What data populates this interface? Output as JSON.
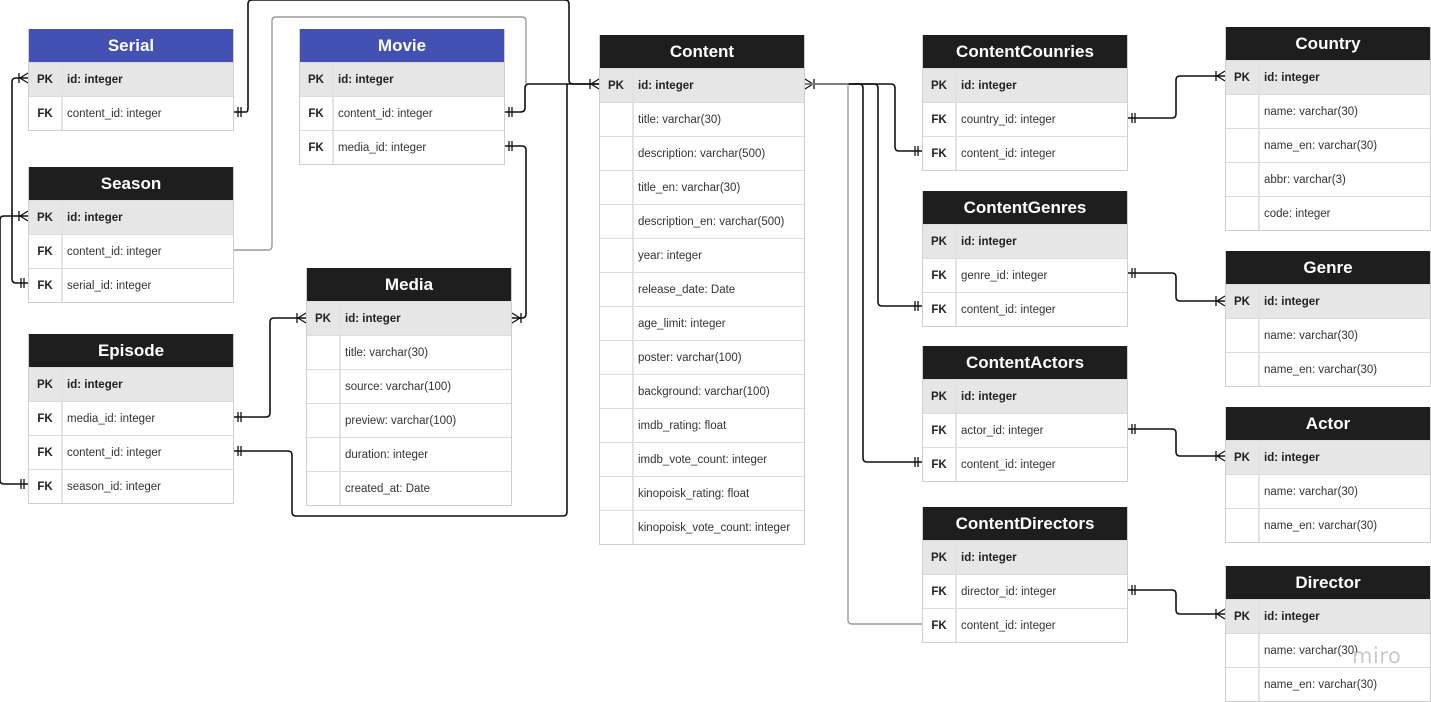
{
  "diagram": {
    "watermark": "miro",
    "entities": {
      "serial": {
        "title": "Serial",
        "rows": [
          {
            "key": "PK",
            "field": "id: integer"
          },
          {
            "key": "FK",
            "field": "content_id: integer"
          }
        ]
      },
      "movie": {
        "title": "Movie",
        "rows": [
          {
            "key": "PK",
            "field": "id: integer"
          },
          {
            "key": "FK",
            "field": "content_id: integer"
          },
          {
            "key": "FK",
            "field": "media_id: integer"
          }
        ]
      },
      "season": {
        "title": "Season",
        "rows": [
          {
            "key": "PK",
            "field": "id: integer"
          },
          {
            "key": "FK",
            "field": "content_id: integer"
          },
          {
            "key": "FK",
            "field": "serial_id: integer"
          }
        ]
      },
      "episode": {
        "title": "Episode",
        "rows": [
          {
            "key": "PK",
            "field": "id: integer"
          },
          {
            "key": "FK",
            "field": "media_id: integer"
          },
          {
            "key": "FK",
            "field": "content_id: integer"
          },
          {
            "key": "FK",
            "field": "season_id: integer"
          }
        ]
      },
      "media": {
        "title": "Media",
        "rows": [
          {
            "key": "PK",
            "field": "id: integer"
          },
          {
            "key": "",
            "field": "title: varchar(30)"
          },
          {
            "key": "",
            "field": "source: varchar(100)"
          },
          {
            "key": "",
            "field": "preview: varchar(100)"
          },
          {
            "key": "",
            "field": "duration: integer"
          },
          {
            "key": "",
            "field": "created_at: Date"
          }
        ]
      },
      "content": {
        "title": "Content",
        "rows": [
          {
            "key": "PK",
            "field": "id: integer"
          },
          {
            "key": "",
            "field": "title: varchar(30)"
          },
          {
            "key": "",
            "field": "description: varchar(500)"
          },
          {
            "key": "",
            "field": "title_en: varchar(30)"
          },
          {
            "key": "",
            "field": "description_en: varchar(500)"
          },
          {
            "key": "",
            "field": "year: integer"
          },
          {
            "key": "",
            "field": "release_date: Date"
          },
          {
            "key": "",
            "field": "age_limit: integer"
          },
          {
            "key": "",
            "field": "poster: varchar(100)"
          },
          {
            "key": "",
            "field": "background: varchar(100)"
          },
          {
            "key": "",
            "field": "imdb_rating: float"
          },
          {
            "key": "",
            "field": "imdb_vote_count: integer"
          },
          {
            "key": "",
            "field": "kinopoisk_rating: float"
          },
          {
            "key": "",
            "field": "kinopoisk_vote_count: integer"
          }
        ]
      },
      "content_countries": {
        "title": "ContentCounries",
        "rows": [
          {
            "key": "PK",
            "field": "id: integer"
          },
          {
            "key": "FK",
            "field": "country_id: integer"
          },
          {
            "key": "FK",
            "field": "content_id: integer"
          }
        ]
      },
      "content_genres": {
        "title": "ContentGenres",
        "rows": [
          {
            "key": "PK",
            "field": "id: integer"
          },
          {
            "key": "FK",
            "field": "genre_id: integer"
          },
          {
            "key": "FK",
            "field": "content_id: integer"
          }
        ]
      },
      "content_actors": {
        "title": "ContentActors",
        "rows": [
          {
            "key": "PK",
            "field": "id: integer"
          },
          {
            "key": "FK",
            "field": "actor_id: integer"
          },
          {
            "key": "FK",
            "field": "content_id: integer"
          }
        ]
      },
      "content_directors": {
        "title": "ContentDirectors",
        "rows": [
          {
            "key": "PK",
            "field": "id: integer"
          },
          {
            "key": "FK",
            "field": "director_id: integer"
          },
          {
            "key": "FK",
            "field": "content_id: integer"
          }
        ]
      },
      "country": {
        "title": "Country",
        "rows": [
          {
            "key": "PK",
            "field": "id: integer"
          },
          {
            "key": "",
            "field": "name: varchar(30)"
          },
          {
            "key": "",
            "field": "name_en: varchar(30)"
          },
          {
            "key": "",
            "field": "abbr: varchar(3)"
          },
          {
            "key": "",
            "field": "code: integer"
          }
        ]
      },
      "genre": {
        "title": "Genre",
        "rows": [
          {
            "key": "PK",
            "field": "id: integer"
          },
          {
            "key": "",
            "field": "name: varchar(30)"
          },
          {
            "key": "",
            "field": "name_en: varchar(30)"
          }
        ]
      },
      "actor": {
        "title": "Actor",
        "rows": [
          {
            "key": "PK",
            "field": "id: integer"
          },
          {
            "key": "",
            "field": "name: varchar(30)"
          },
          {
            "key": "",
            "field": "name_en: varchar(30)"
          }
        ]
      },
      "director": {
        "title": "Director",
        "rows": [
          {
            "key": "PK",
            "field": "id: integer"
          },
          {
            "key": "",
            "field": "name: varchar(30)"
          },
          {
            "key": "",
            "field": "name_en: varchar(30)"
          }
        ]
      }
    },
    "relations": [
      {
        "from": "serial.content_id",
        "to": "content.id",
        "from_end": "one-mandatory",
        "to_end": "one-or-many"
      },
      {
        "from": "movie.content_id",
        "to": "content.id",
        "from_end": "one-mandatory",
        "to_end": "one-or-many"
      },
      {
        "from": "movie.media_id",
        "to": "media.id",
        "from_end": "one-mandatory",
        "to_end": "one-or-many"
      },
      {
        "from": "season.content_id",
        "to": "content.id",
        "from_end": "none",
        "to_end": "none"
      },
      {
        "from": "season.serial_id",
        "to": "serial.id",
        "from_end": "one-mandatory",
        "to_end": "one-or-many"
      },
      {
        "from": "episode.media_id",
        "to": "media.id",
        "from_end": "one-mandatory",
        "to_end": "one-or-many"
      },
      {
        "from": "episode.content_id",
        "to": "content.id",
        "from_end": "one-mandatory",
        "to_end": "one-or-many"
      },
      {
        "from": "episode.season_id",
        "to": "season.id",
        "from_end": "one-mandatory",
        "to_end": "one-or-many"
      },
      {
        "from": "content_countries.content_id",
        "to": "content.id",
        "from_end": "one-mandatory",
        "to_end": "one-or-many"
      },
      {
        "from": "content_genres.content_id",
        "to": "content.id",
        "from_end": "one-mandatory",
        "to_end": "one-or-many"
      },
      {
        "from": "content_actors.content_id",
        "to": "content.id",
        "from_end": "one-mandatory",
        "to_end": "one-or-many"
      },
      {
        "from": "content_directors.content_id",
        "to": "content.id",
        "from_end": "none",
        "to_end": "one-or-many"
      },
      {
        "from": "content_countries.country_id",
        "to": "country.id",
        "from_end": "one-mandatory",
        "to_end": "one-or-many"
      },
      {
        "from": "content_genres.genre_id",
        "to": "genre.id",
        "from_end": "one-mandatory",
        "to_end": "one-or-many"
      },
      {
        "from": "content_actors.actor_id",
        "to": "actor.id",
        "from_end": "one-mandatory",
        "to_end": "one-or-many"
      },
      {
        "from": "content_directors.director_id",
        "to": "director.id",
        "from_end": "one-mandatory",
        "to_end": "one-or-many"
      }
    ]
  }
}
